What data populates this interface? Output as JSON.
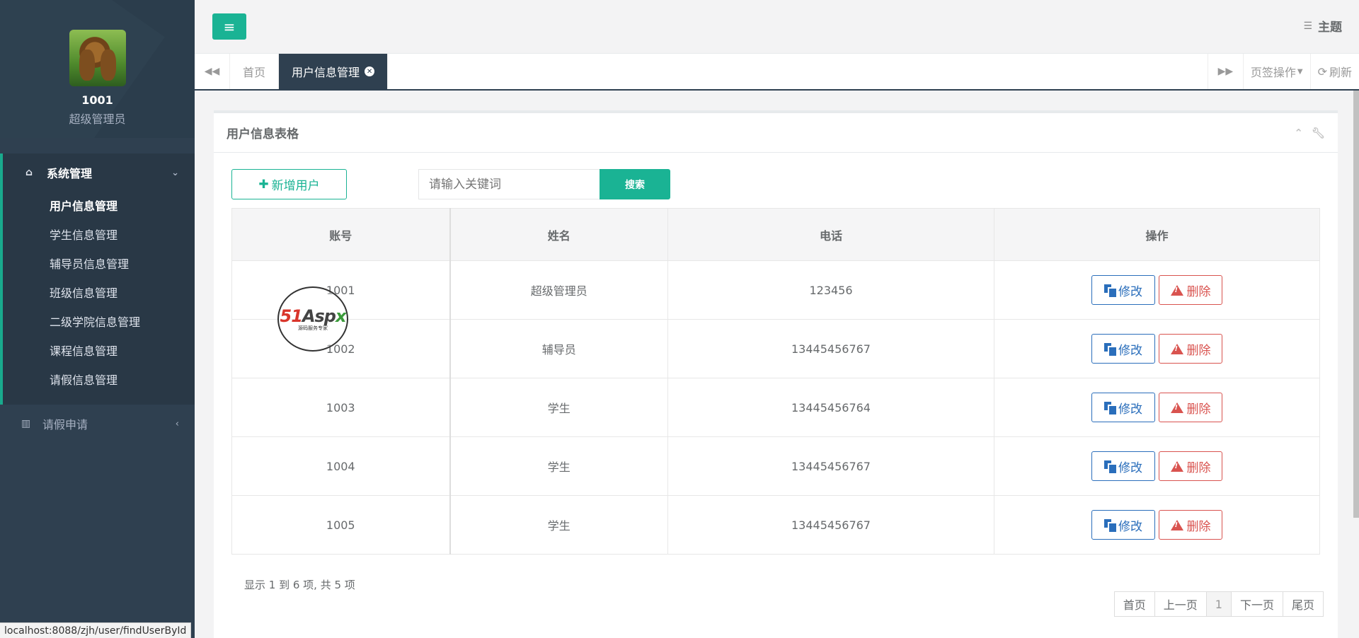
{
  "sidebar": {
    "user_id": "1001",
    "user_role": "超级管理员",
    "groups": [
      {
        "label": "系统管理",
        "icon": "home-icon",
        "items": [
          {
            "label": "用户信息管理"
          },
          {
            "label": "学生信息管理"
          },
          {
            "label": "辅导员信息管理"
          },
          {
            "label": "班级信息管理"
          },
          {
            "label": "二级学院信息管理"
          },
          {
            "label": "课程信息管理"
          },
          {
            "label": "请假信息管理"
          }
        ]
      },
      {
        "label": "请假申请",
        "icon": "bar-chart-icon"
      }
    ]
  },
  "header": {
    "theme_label": "主题"
  },
  "tabs": {
    "items": [
      {
        "label": "首页"
      },
      {
        "label": "用户信息管理"
      }
    ],
    "page_ops_label": "页签操作",
    "refresh_label": "刷新"
  },
  "panel": {
    "title": "用户信息表格",
    "add_button_label": "新增用户",
    "search_placeholder": "请输入关键词",
    "search_button_label": "搜索"
  },
  "table": {
    "columns": [
      "账号",
      "姓名",
      "电话",
      "操作"
    ],
    "rows": [
      {
        "account": "1001",
        "name": "超级管理员",
        "phone": "123456"
      },
      {
        "account": "1002",
        "name": "辅导员",
        "phone": "13445456767"
      },
      {
        "account": "1003",
        "name": "学生",
        "phone": "13445456764"
      },
      {
        "account": "1004",
        "name": "学生",
        "phone": "13445456767"
      },
      {
        "account": "1005",
        "name": "学生",
        "phone": "13445456767"
      }
    ],
    "edit_label": "修改",
    "delete_label": "删除"
  },
  "watermark": {
    "brand_51": "51",
    "brand_asp": "Asp",
    "brand_x": "x",
    "tagline": "源码服务专家"
  },
  "pagination": {
    "info": "显示 1 到 6 项, 共 5 项",
    "first": "首页",
    "prev": "上一页",
    "current": "1",
    "next": "下一页",
    "last": "尾页"
  },
  "status_bar": {
    "url": "localhost:8088/zjh/user/findUserById"
  },
  "colors": {
    "sidebar_bg": "#2f4050",
    "accent": "#1ab394",
    "edit": "#2a6ebb",
    "delete": "#d9534f"
  }
}
